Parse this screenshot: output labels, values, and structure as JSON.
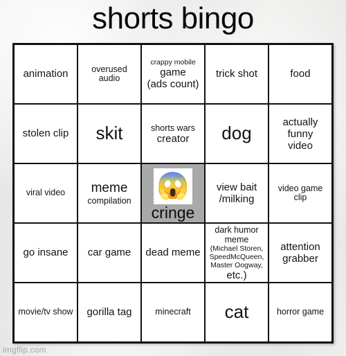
{
  "title": "shorts bingo",
  "watermark": "imgflip.com",
  "colors": {
    "free_space_bg": "#a9a9a9",
    "cell_bg": "#ffffff",
    "grid_line": "#111111",
    "page_bg": "#e8e8e6",
    "text": "#131313"
  },
  "grid": {
    "columns": 5,
    "rows": 5,
    "cells": [
      {
        "id": "r1c1",
        "text": "animation",
        "size": "md"
      },
      {
        "id": "r1c2",
        "text": "overused audio",
        "size": "sm"
      },
      {
        "id": "r1c3",
        "lines": [
          "crappy mobile",
          "game",
          "(ads count)"
        ],
        "line_sizes": [
          "xs",
          "md",
          "md"
        ]
      },
      {
        "id": "r1c4",
        "text": "trick shot",
        "size": "md"
      },
      {
        "id": "r1c5",
        "text": "food",
        "size": "md"
      },
      {
        "id": "r2c1",
        "text": "stolen clip",
        "size": "md"
      },
      {
        "id": "r2c2",
        "text": "skit",
        "size": "xl"
      },
      {
        "id": "r2c3",
        "lines": [
          "shorts wars",
          "creator"
        ],
        "line_sizes": [
          "sm",
          "md"
        ]
      },
      {
        "id": "r2c4",
        "text": "dog",
        "size": "xl"
      },
      {
        "id": "r2c5",
        "lines": [
          "actually funny",
          "video"
        ],
        "line_sizes": [
          "md",
          "md"
        ]
      },
      {
        "id": "r3c1",
        "text": "viral video",
        "size": "sm"
      },
      {
        "id": "r3c2",
        "lines": [
          "meme",
          "compilation"
        ],
        "line_sizes": [
          "lg",
          "sm"
        ]
      },
      {
        "id": "r3c3",
        "free": true,
        "emoji": "😱",
        "emoji_name": "face-screaming-in-fear-emoji",
        "text": "cringe"
      },
      {
        "id": "r3c4",
        "lines": [
          "view bait",
          "/milking"
        ],
        "line_sizes": [
          "md",
          "md"
        ]
      },
      {
        "id": "r3c5",
        "text": "video game clip",
        "size": "sm"
      },
      {
        "id": "r4c1",
        "text": "go insane",
        "size": "md"
      },
      {
        "id": "r4c2",
        "text": "car game",
        "size": "md"
      },
      {
        "id": "r4c3",
        "text": "dead meme",
        "size": "md"
      },
      {
        "id": "r4c4",
        "lines": [
          "dark humor meme",
          "(Michael Storen,",
          "SpeedMcQueen,",
          "Master Oogway,",
          "etc.)"
        ],
        "line_sizes": [
          "sm",
          "xs",
          "xs",
          "xs",
          "md"
        ]
      },
      {
        "id": "r4c5",
        "lines": [
          "attention",
          "grabber"
        ],
        "line_sizes": [
          "md",
          "md"
        ]
      },
      {
        "id": "r5c1",
        "text": "movie/tv show",
        "size": "sm"
      },
      {
        "id": "r5c2",
        "text": "gorilla tag",
        "size": "md"
      },
      {
        "id": "r5c3",
        "text": "minecraft",
        "size": "sm"
      },
      {
        "id": "r5c4",
        "text": "cat",
        "size": "xl"
      },
      {
        "id": "r5c5",
        "text": "horror game",
        "size": "sm"
      }
    ]
  }
}
